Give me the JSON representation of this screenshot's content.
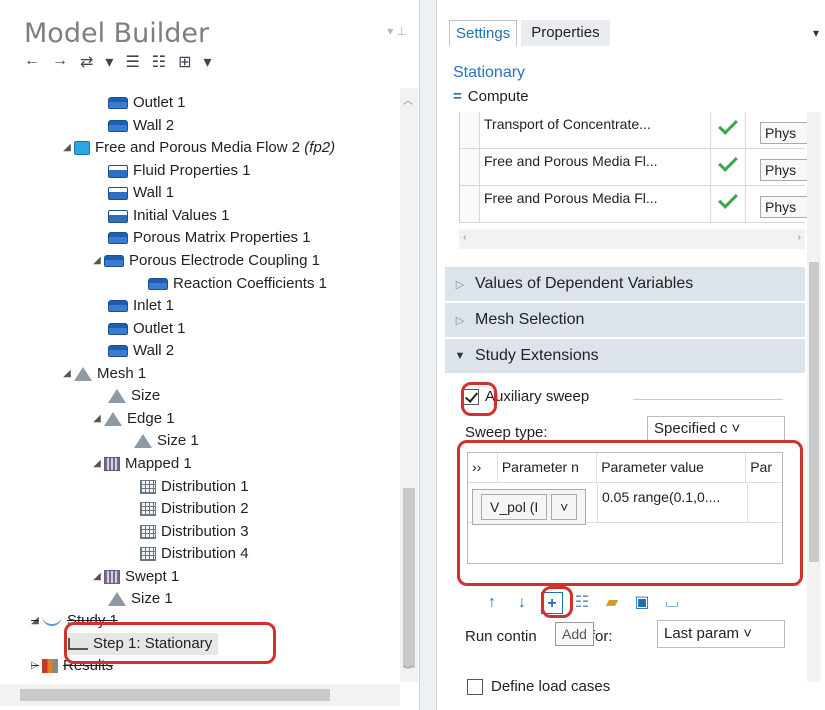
{
  "left_panel": {
    "title": "Model Builder",
    "toolbar": [
      "←",
      "→",
      "⇄",
      "▾",
      "☰",
      "☷",
      "⊞",
      "▾"
    ],
    "tree": [
      {
        "label": "Outlet 1"
      },
      {
        "label": "Wall 2"
      },
      {
        "label": "Free and Porous Media Flow 2",
        "suffix": "(fp2)"
      },
      {
        "label": "Fluid Properties 1"
      },
      {
        "label": "Wall 1"
      },
      {
        "label": "Initial Values 1"
      },
      {
        "label": "Porous Matrix Properties 1"
      },
      {
        "label": "Porous Electrode Coupling 1"
      },
      {
        "label": "Reaction Coefficients 1"
      },
      {
        "label": "Inlet 1"
      },
      {
        "label": "Outlet 1"
      },
      {
        "label": "Wall 2"
      },
      {
        "label": "Mesh 1"
      },
      {
        "label": "Size"
      },
      {
        "label": "Edge 1"
      },
      {
        "label": "Size 1"
      },
      {
        "label": "Mapped 1"
      },
      {
        "label": "Distribution 1"
      },
      {
        "label": "Distribution 2"
      },
      {
        "label": "Distribution 3"
      },
      {
        "label": "Distribution 4"
      },
      {
        "label": "Swept 1"
      },
      {
        "label": "Size 1"
      },
      {
        "label": "Study 1"
      },
      {
        "label": "Step 1: Stationary"
      },
      {
        "label": "Results"
      }
    ]
  },
  "right_panel": {
    "tabs": [
      "Settings",
      "Properties"
    ],
    "section_title": "Stationary",
    "compute_label": "Compute",
    "physics_rows": [
      {
        "name": "Transport of Concentrate...",
        "button": "Phys"
      },
      {
        "name": "Free and Porous Media Fl...",
        "button": "Phys"
      },
      {
        "name": "Free and Porous Media Fl...",
        "button": "Phys"
      }
    ],
    "sections": [
      "Values of Dependent Variables",
      "Mesh Selection",
      "Study Extensions"
    ],
    "study_extensions": {
      "aux_sweep_label": "Auxiliary sweep",
      "sweep_type_label": "Sweep type:",
      "sweep_type_value": "Specified c",
      "grid_headers": [
        "Parameter n",
        "Parameter value",
        "Par"
      ],
      "grid_row": {
        "name": "V_pol (I",
        "value": "0.05 range(0.1,0...."
      },
      "tooltip": "Add",
      "run_label": "Run contin",
      "for_label": "for:",
      "run_value": "Last param",
      "define_load_cases": "Define load cases"
    }
  }
}
